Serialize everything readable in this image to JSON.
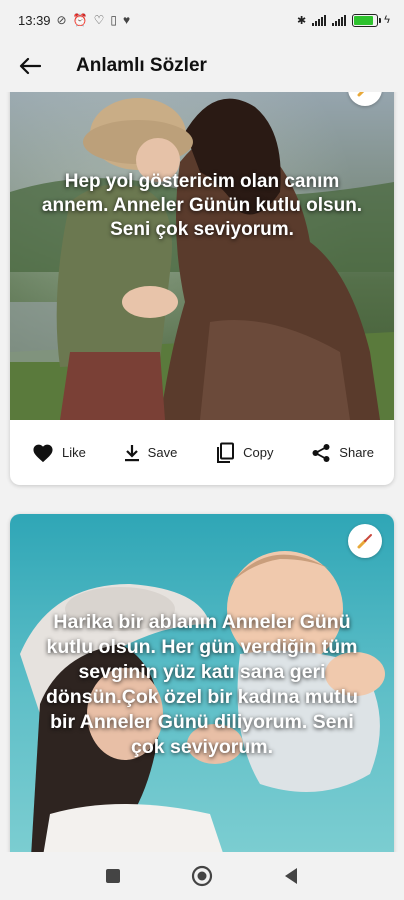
{
  "status_bar": {
    "time": "13:39",
    "battery_level": 0.85,
    "icons": [
      "no-sim-icon",
      "alarm-icon",
      "heart-icon",
      "vibrate-icon",
      "bluetooth-icon",
      "signal-icon",
      "charging-icon"
    ]
  },
  "app_bar": {
    "title": "Anlamlı Sözler",
    "back_icon": "arrow-left-icon"
  },
  "cards": [
    {
      "quote": "Hep yol göstericim olan canım annem. Anneler Günün kutlu olsun. Seni çok seviyorum.",
      "actions": {
        "like": "Like",
        "save": "Save",
        "copy": "Copy",
        "share": "Share"
      }
    },
    {
      "quote": "Harika bir ablanın Anneler Günü kutlu olsun. Her gün verdiğin tüm sevginin yüz katı sana geri dönsün.Çok özel bir kadına mutlu bir Anneler Günü diliyorum. Seni çok seviyorum."
    }
  ],
  "colors": {
    "accent": "#222222",
    "battery": "#2ec22e",
    "background": "#f2f2f2"
  }
}
